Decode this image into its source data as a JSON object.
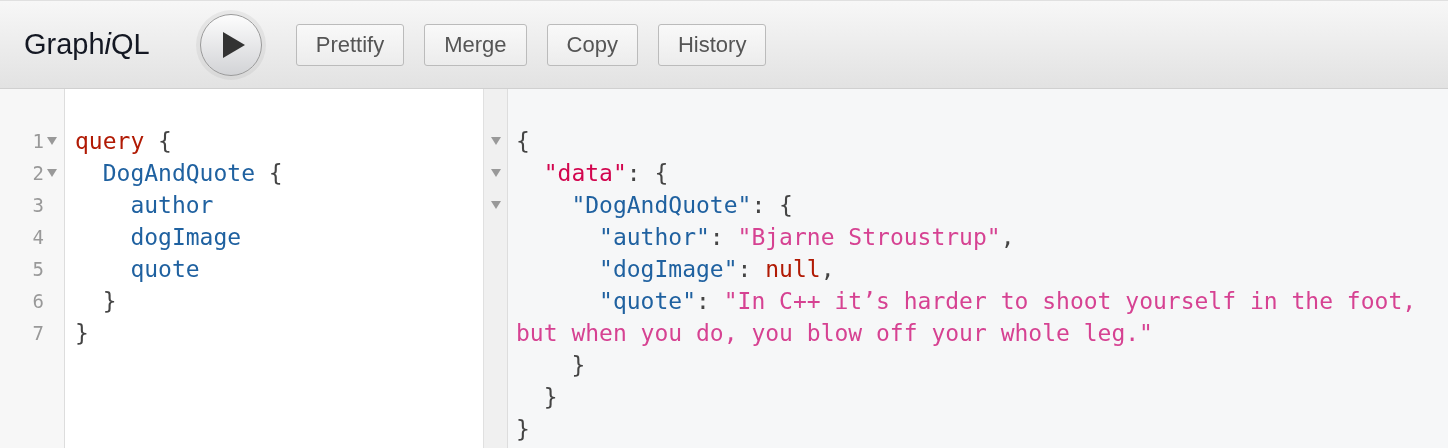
{
  "toolbar": {
    "title": [
      {
        "text": "Graph",
        "italic": false
      },
      {
        "text": "i",
        "italic": true
      },
      {
        "text": "QL",
        "italic": false
      }
    ],
    "buttons": [
      "Prettify",
      "Merge",
      "Copy",
      "History"
    ]
  },
  "query_editor": {
    "lines": [
      {
        "number": "1",
        "foldable": true,
        "tokens": [
          {
            "kind": "keyword",
            "text": "query"
          },
          {
            "kind": "punct",
            "text": " {"
          }
        ],
        "children": [
          {
            "number": "2",
            "foldable": true,
            "tokens": [
              {
                "kind": "field",
                "text": "DogAndQuote"
              },
              {
                "kind": "punct",
                "text": " {"
              }
            ],
            "children": [
              {
                "number": "3",
                "foldable": false,
                "tokens": [
                  {
                    "kind": "field",
                    "text": "author"
                  }
                ]
              },
              {
                "number": "4",
                "foldable": false,
                "tokens": [
                  {
                    "kind": "field",
                    "text": "dogImage"
                  }
                ]
              },
              {
                "number": "5",
                "foldable": false,
                "tokens": [
                  {
                    "kind": "field",
                    "text": "quote"
                  }
                ]
              }
            ]
          },
          {
            "number": "6",
            "foldable": false,
            "tokens": [
              {
                "kind": "punct",
                "text": "}"
              }
            ]
          }
        ]
      },
      {
        "number": "7",
        "foldable": false,
        "tokens": [
          {
            "kind": "punct",
            "text": "}"
          }
        ]
      }
    ]
  },
  "result_viewer": {
    "lines": [
      {
        "foldable": true,
        "tokens": [
          {
            "kind": "punct",
            "text": "{"
          }
        ],
        "children": [
          {
            "foldable": true,
            "tokens": [
              {
                "kind": "key",
                "text": "\"data\""
              },
              {
                "kind": "punct",
                "text": ": {"
              }
            ],
            "children": [
              {
                "foldable": true,
                "tokens": [
                  {
                    "kind": "field",
                    "text": "\"DogAndQuote\""
                  },
                  {
                    "kind": "punct",
                    "text": ": {"
                  }
                ],
                "children": [
                  {
                    "foldable": false,
                    "tokens": [
                      {
                        "kind": "field",
                        "text": "\"author\""
                      },
                      {
                        "kind": "punct",
                        "text": ": "
                      },
                      {
                        "kind": "string",
                        "text": "\"Bjarne Stroustrup\""
                      },
                      {
                        "kind": "punct",
                        "text": ","
                      }
                    ]
                  },
                  {
                    "foldable": false,
                    "tokens": [
                      {
                        "kind": "field",
                        "text": "\"dogImage\""
                      },
                      {
                        "kind": "punct",
                        "text": ": "
                      },
                      {
                        "kind": "keyword",
                        "text": "null"
                      },
                      {
                        "kind": "punct",
                        "text": ","
                      }
                    ]
                  },
                  {
                    "foldable": false,
                    "tokens": [
                      {
                        "kind": "field",
                        "text": "\"quote\""
                      },
                      {
                        "kind": "punct",
                        "text": ": "
                      },
                      {
                        "kind": "string",
                        "text": "\"In C++ it’s harder to shoot yourself in the foot, but when you do, you blow off your whole leg.\""
                      }
                    ]
                  }
                ]
              },
              {
                "foldable": false,
                "tokens": [
                  {
                    "kind": "punct",
                    "text": "}"
                  }
                ]
              }
            ]
          },
          {
            "foldable": false,
            "tokens": [
              {
                "kind": "punct",
                "text": "}"
              }
            ]
          }
        ]
      },
      {
        "foldable": false,
        "tokens": [
          {
            "kind": "punct",
            "text": "}"
          }
        ]
      }
    ]
  }
}
